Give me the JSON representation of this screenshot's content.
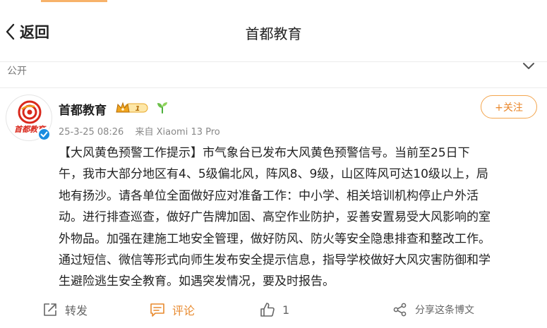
{
  "header": {
    "back_label": "返回",
    "title": "首都教育"
  },
  "visibility": {
    "label": "公开"
  },
  "post": {
    "author": "首都教育",
    "avatar_text": "首都教育",
    "vip_level": "1",
    "timestamp": "25-3-25 08:26",
    "source": "来自 Xiaomi 13 Pro",
    "follow_label": "+关注",
    "content_lines": [
      "【大风黄色预警工作提示】市气象台已发布大风黄色预警信号。当前至25日下",
      "午，我市大部分地区有4、5级偏北风，阵风8、9级，山区阵风可达10级以上，局",
      "地有扬沙。请各单位全面做好应对准备工作：中小学、相关培训机构停止户外活",
      "动。进行排查巡查，做好广告牌加固、高空作业防护，妥善安置易受大风影响的室",
      "外物品。加强在建施工地安全管理，做好防风、防火等安全隐患排查和整改工作。",
      "通过短信、微信等形式向师生发布安全提示信息，指导学校做好大风灾害防御和学",
      "生避险逃生安全教育。如遇突发情况，要及时报告。"
    ]
  },
  "actions": {
    "repost_label": "转发",
    "comment_label": "评论",
    "like_count": "1",
    "share_label": "分享这条博文"
  },
  "colors": {
    "accent": "#e98528",
    "verify_blue": "#1a8ce0",
    "avatar_red": "#d9281c"
  }
}
